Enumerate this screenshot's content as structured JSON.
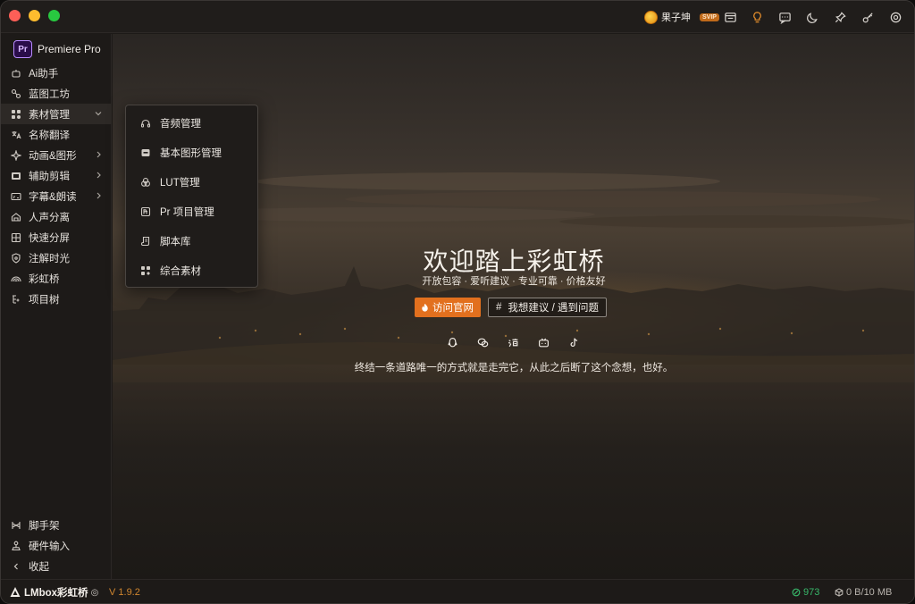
{
  "titlebar": {
    "user_name": "果子坤",
    "vip_badge": "SVIP",
    "icons": [
      "store-icon",
      "lightbulb-icon",
      "message-icon",
      "moon-icon",
      "pin-icon",
      "key-icon",
      "settings-icon"
    ]
  },
  "sidebar": {
    "app_logo": "Pr",
    "app_name": "Premiere Pro",
    "items": [
      {
        "label": "Ai助手",
        "icon": "robot-icon"
      },
      {
        "label": "蓝图工坊",
        "icon": "blueprint-icon"
      },
      {
        "label": "素材管理",
        "icon": "grid-icon",
        "expanded": true
      },
      {
        "label": "名称翻译",
        "icon": "translate-icon"
      },
      {
        "label": "动画&图形",
        "icon": "sparkle-icon",
        "has_submenu": true
      },
      {
        "label": "辅助剪辑",
        "icon": "film-icon",
        "has_submenu": true
      },
      {
        "label": "字幕&朗读",
        "icon": "caption-icon",
        "has_submenu": true
      },
      {
        "label": "人声分离",
        "icon": "house-icon"
      },
      {
        "label": "快速分屏",
        "icon": "split-icon"
      },
      {
        "label": "注解时光",
        "icon": "shield-icon"
      },
      {
        "label": "彩虹桥",
        "icon": "rainbow-icon"
      },
      {
        "label": "项目树",
        "icon": "tree-icon"
      }
    ],
    "bottom_items": [
      {
        "label": "脚手架",
        "icon": "scaffold-icon"
      },
      {
        "label": "硬件输入",
        "icon": "joystick-icon"
      },
      {
        "label": "收起",
        "icon": "collapse-icon"
      }
    ]
  },
  "flyout": {
    "items": [
      {
        "label": "音频管理",
        "icon": "headphones-icon"
      },
      {
        "label": "基本图形管理",
        "icon": "graphic-icon"
      },
      {
        "label": "LUT管理",
        "icon": "color-circles-icon"
      },
      {
        "label": "Pr 项目管理",
        "icon": "pr-file-icon"
      },
      {
        "label": "脚本库",
        "icon": "script-icon"
      },
      {
        "label": "综合素材",
        "icon": "mixed-grid-icon"
      }
    ]
  },
  "hero": {
    "title": "欢迎踏上彩虹桥",
    "subtitle": "开放包容 · 爱听建议 · 专业可靠 · 价格友好",
    "primary_button": "访问官网",
    "secondary_button": "我想建议 / 遇到问题",
    "socials": [
      "qq-icon",
      "wechat-icon",
      "taobao-icon",
      "bilibili-icon",
      "tiktok-icon"
    ],
    "quote": "终结一条道路唯一的方式就是走完它，从此之后断了这个念想，也好。"
  },
  "statusbar": {
    "brand": "LMbox彩虹桥",
    "version": "V 1.9.2",
    "online": "973",
    "storage": "0 B/10 MB"
  },
  "colors": {
    "accent": "#e2701e",
    "version": "#d0862f",
    "online": "#38b76a"
  }
}
